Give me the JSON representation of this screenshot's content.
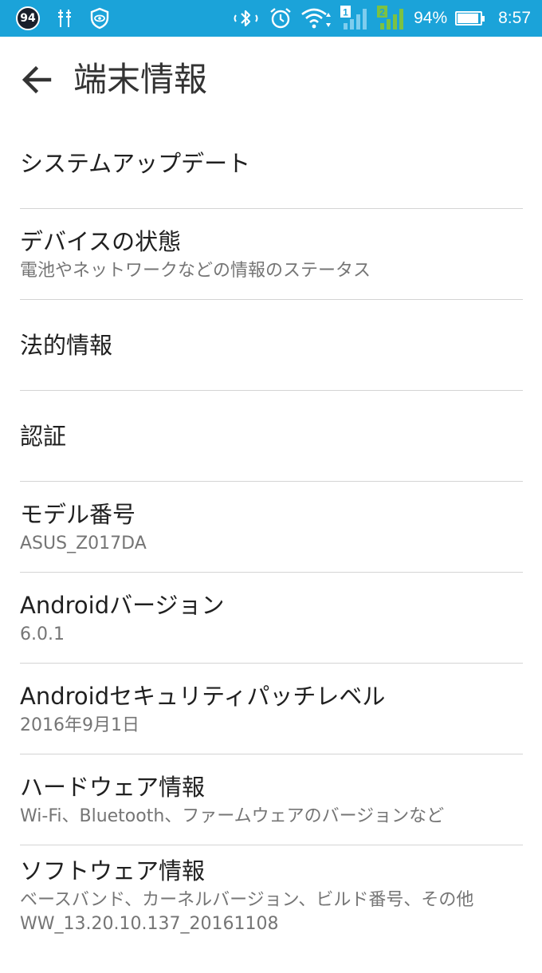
{
  "status_bar": {
    "notification_badge": "94",
    "battery_percent": "94%",
    "battery_level": 0.94,
    "time": "8:57",
    "sim1_label": "1",
    "sim2_label": "2",
    "icons": [
      "notification-badge",
      "usb-debug-icon",
      "shield-eye-icon",
      "bluetooth-icon",
      "alarm-icon",
      "wifi-icon",
      "sim1-signal-icon",
      "sim2-signal-icon",
      "battery-icon"
    ]
  },
  "header": {
    "title": "端末情報",
    "back_icon": "arrow-back-icon"
  },
  "colors": {
    "status_bar": "#1ba3d9",
    "background": "#ffffff",
    "title_text": "#202020",
    "subtitle_text": "#757575",
    "sim2_green": "#7cc242"
  },
  "items": [
    {
      "title": "システムアップデート",
      "subtitle": ""
    },
    {
      "title": "デバイスの状態",
      "subtitle": "電池やネットワークなどの情報のステータス"
    },
    {
      "title": "法的情報",
      "subtitle": ""
    },
    {
      "title": "認証",
      "subtitle": ""
    },
    {
      "title": "モデル番号",
      "subtitle": "ASUS_Z017DA"
    },
    {
      "title": "Androidバージョン",
      "subtitle": "6.0.1"
    },
    {
      "title": "Androidセキュリティパッチレベル",
      "subtitle": "2016年9月1日"
    },
    {
      "title": "ハードウェア情報",
      "subtitle": "Wi-Fi、Bluetooth、ファームウェアのバージョンなど"
    },
    {
      "title": "ソフトウェア情報",
      "subtitle": "ベースバンド、カーネルバージョン、ビルド番号、その他",
      "subtitle2": "WW_13.20.10.137_20161108"
    }
  ]
}
